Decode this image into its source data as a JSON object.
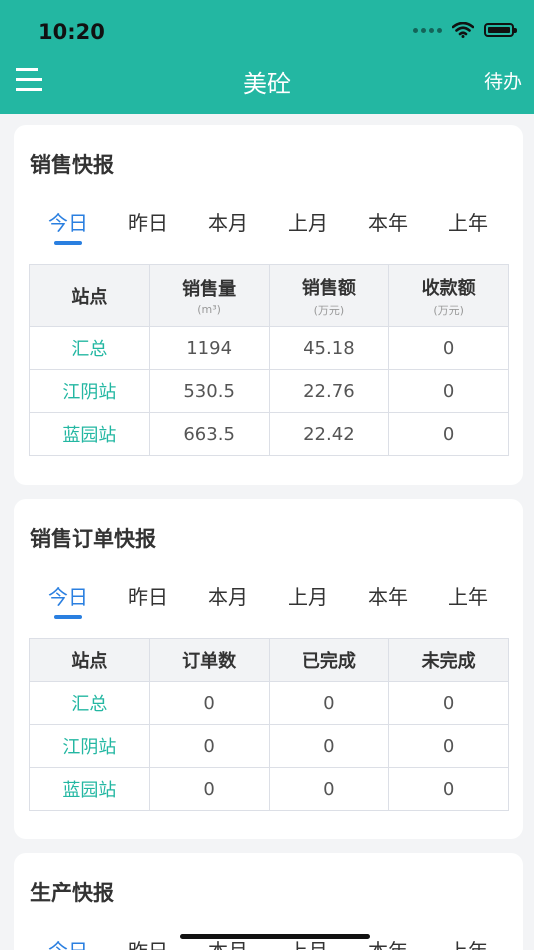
{
  "status": {
    "time": "10:20"
  },
  "nav": {
    "title": "美砼",
    "right_label": "待办"
  },
  "tabs": [
    "今日",
    "昨日",
    "本月",
    "上月",
    "本年",
    "上年"
  ],
  "sales_report": {
    "title": "销售快报",
    "headers": [
      {
        "label": "站点",
        "unit": ""
      },
      {
        "label": "销售量",
        "unit": "(m³)"
      },
      {
        "label": "销售额",
        "unit": "(万元)"
      },
      {
        "label": "收款额",
        "unit": "(万元)"
      }
    ],
    "rows": [
      [
        "汇总",
        "1194",
        "45.18",
        "0"
      ],
      [
        "江阴站",
        "530.5",
        "22.76",
        "0"
      ],
      [
        "蓝园站",
        "663.5",
        "22.42",
        "0"
      ]
    ]
  },
  "order_report": {
    "title": "销售订单快报",
    "headers": [
      "站点",
      "订单数",
      "已完成",
      "未完成"
    ],
    "rows": [
      [
        "汇总",
        "0",
        "0",
        "0"
      ],
      [
        "江阴站",
        "0",
        "0",
        "0"
      ],
      [
        "蓝园站",
        "0",
        "0",
        "0"
      ]
    ]
  },
  "production_report": {
    "title": "生产快报"
  },
  "colors": {
    "accent": "#23b7a2",
    "tab_active": "#2a7fe0"
  }
}
